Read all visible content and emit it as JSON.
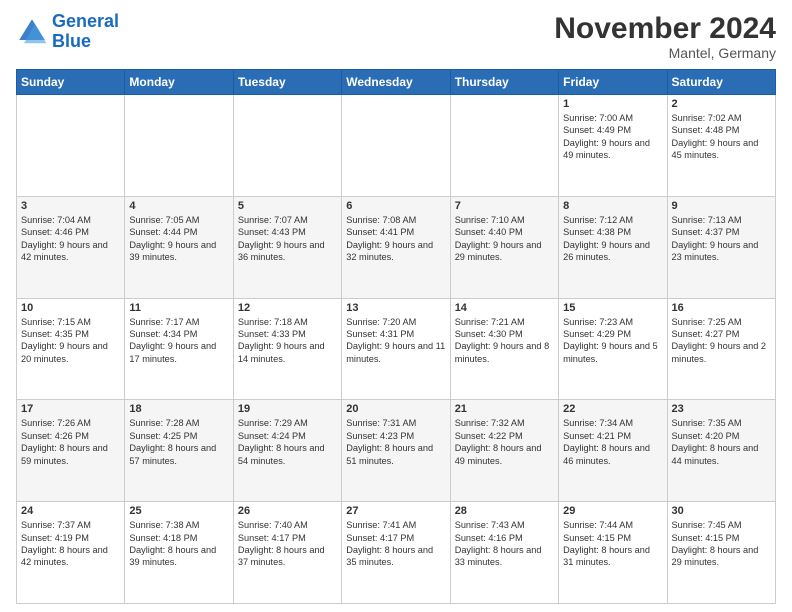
{
  "header": {
    "logo_line1": "General",
    "logo_line2": "Blue",
    "month": "November 2024",
    "location": "Mantel, Germany"
  },
  "days_of_week": [
    "Sunday",
    "Monday",
    "Tuesday",
    "Wednesday",
    "Thursday",
    "Friday",
    "Saturday"
  ],
  "weeks": [
    [
      {
        "day": "",
        "sunrise": "",
        "sunset": "",
        "daylight": ""
      },
      {
        "day": "",
        "sunrise": "",
        "sunset": "",
        "daylight": ""
      },
      {
        "day": "",
        "sunrise": "",
        "sunset": "",
        "daylight": ""
      },
      {
        "day": "",
        "sunrise": "",
        "sunset": "",
        "daylight": ""
      },
      {
        "day": "",
        "sunrise": "",
        "sunset": "",
        "daylight": ""
      },
      {
        "day": "1",
        "sunrise": "Sunrise: 7:00 AM",
        "sunset": "Sunset: 4:49 PM",
        "daylight": "Daylight: 9 hours and 49 minutes."
      },
      {
        "day": "2",
        "sunrise": "Sunrise: 7:02 AM",
        "sunset": "Sunset: 4:48 PM",
        "daylight": "Daylight: 9 hours and 45 minutes."
      }
    ],
    [
      {
        "day": "3",
        "sunrise": "Sunrise: 7:04 AM",
        "sunset": "Sunset: 4:46 PM",
        "daylight": "Daylight: 9 hours and 42 minutes."
      },
      {
        "day": "4",
        "sunrise": "Sunrise: 7:05 AM",
        "sunset": "Sunset: 4:44 PM",
        "daylight": "Daylight: 9 hours and 39 minutes."
      },
      {
        "day": "5",
        "sunrise": "Sunrise: 7:07 AM",
        "sunset": "Sunset: 4:43 PM",
        "daylight": "Daylight: 9 hours and 36 minutes."
      },
      {
        "day": "6",
        "sunrise": "Sunrise: 7:08 AM",
        "sunset": "Sunset: 4:41 PM",
        "daylight": "Daylight: 9 hours and 32 minutes."
      },
      {
        "day": "7",
        "sunrise": "Sunrise: 7:10 AM",
        "sunset": "Sunset: 4:40 PM",
        "daylight": "Daylight: 9 hours and 29 minutes."
      },
      {
        "day": "8",
        "sunrise": "Sunrise: 7:12 AM",
        "sunset": "Sunset: 4:38 PM",
        "daylight": "Daylight: 9 hours and 26 minutes."
      },
      {
        "day": "9",
        "sunrise": "Sunrise: 7:13 AM",
        "sunset": "Sunset: 4:37 PM",
        "daylight": "Daylight: 9 hours and 23 minutes."
      }
    ],
    [
      {
        "day": "10",
        "sunrise": "Sunrise: 7:15 AM",
        "sunset": "Sunset: 4:35 PM",
        "daylight": "Daylight: 9 hours and 20 minutes."
      },
      {
        "day": "11",
        "sunrise": "Sunrise: 7:17 AM",
        "sunset": "Sunset: 4:34 PM",
        "daylight": "Daylight: 9 hours and 17 minutes."
      },
      {
        "day": "12",
        "sunrise": "Sunrise: 7:18 AM",
        "sunset": "Sunset: 4:33 PM",
        "daylight": "Daylight: 9 hours and 14 minutes."
      },
      {
        "day": "13",
        "sunrise": "Sunrise: 7:20 AM",
        "sunset": "Sunset: 4:31 PM",
        "daylight": "Daylight: 9 hours and 11 minutes."
      },
      {
        "day": "14",
        "sunrise": "Sunrise: 7:21 AM",
        "sunset": "Sunset: 4:30 PM",
        "daylight": "Daylight: 9 hours and 8 minutes."
      },
      {
        "day": "15",
        "sunrise": "Sunrise: 7:23 AM",
        "sunset": "Sunset: 4:29 PM",
        "daylight": "Daylight: 9 hours and 5 minutes."
      },
      {
        "day": "16",
        "sunrise": "Sunrise: 7:25 AM",
        "sunset": "Sunset: 4:27 PM",
        "daylight": "Daylight: 9 hours and 2 minutes."
      }
    ],
    [
      {
        "day": "17",
        "sunrise": "Sunrise: 7:26 AM",
        "sunset": "Sunset: 4:26 PM",
        "daylight": "Daylight: 8 hours and 59 minutes."
      },
      {
        "day": "18",
        "sunrise": "Sunrise: 7:28 AM",
        "sunset": "Sunset: 4:25 PM",
        "daylight": "Daylight: 8 hours and 57 minutes."
      },
      {
        "day": "19",
        "sunrise": "Sunrise: 7:29 AM",
        "sunset": "Sunset: 4:24 PM",
        "daylight": "Daylight: 8 hours and 54 minutes."
      },
      {
        "day": "20",
        "sunrise": "Sunrise: 7:31 AM",
        "sunset": "Sunset: 4:23 PM",
        "daylight": "Daylight: 8 hours and 51 minutes."
      },
      {
        "day": "21",
        "sunrise": "Sunrise: 7:32 AM",
        "sunset": "Sunset: 4:22 PM",
        "daylight": "Daylight: 8 hours and 49 minutes."
      },
      {
        "day": "22",
        "sunrise": "Sunrise: 7:34 AM",
        "sunset": "Sunset: 4:21 PM",
        "daylight": "Daylight: 8 hours and 46 minutes."
      },
      {
        "day": "23",
        "sunrise": "Sunrise: 7:35 AM",
        "sunset": "Sunset: 4:20 PM",
        "daylight": "Daylight: 8 hours and 44 minutes."
      }
    ],
    [
      {
        "day": "24",
        "sunrise": "Sunrise: 7:37 AM",
        "sunset": "Sunset: 4:19 PM",
        "daylight": "Daylight: 8 hours and 42 minutes."
      },
      {
        "day": "25",
        "sunrise": "Sunrise: 7:38 AM",
        "sunset": "Sunset: 4:18 PM",
        "daylight": "Daylight: 8 hours and 39 minutes."
      },
      {
        "day": "26",
        "sunrise": "Sunrise: 7:40 AM",
        "sunset": "Sunset: 4:17 PM",
        "daylight": "Daylight: 8 hours and 37 minutes."
      },
      {
        "day": "27",
        "sunrise": "Sunrise: 7:41 AM",
        "sunset": "Sunset: 4:17 PM",
        "daylight": "Daylight: 8 hours and 35 minutes."
      },
      {
        "day": "28",
        "sunrise": "Sunrise: 7:43 AM",
        "sunset": "Sunset: 4:16 PM",
        "daylight": "Daylight: 8 hours and 33 minutes."
      },
      {
        "day": "29",
        "sunrise": "Sunrise: 7:44 AM",
        "sunset": "Sunset: 4:15 PM",
        "daylight": "Daylight: 8 hours and 31 minutes."
      },
      {
        "day": "30",
        "sunrise": "Sunrise: 7:45 AM",
        "sunset": "Sunset: 4:15 PM",
        "daylight": "Daylight: 8 hours and 29 minutes."
      }
    ]
  ]
}
